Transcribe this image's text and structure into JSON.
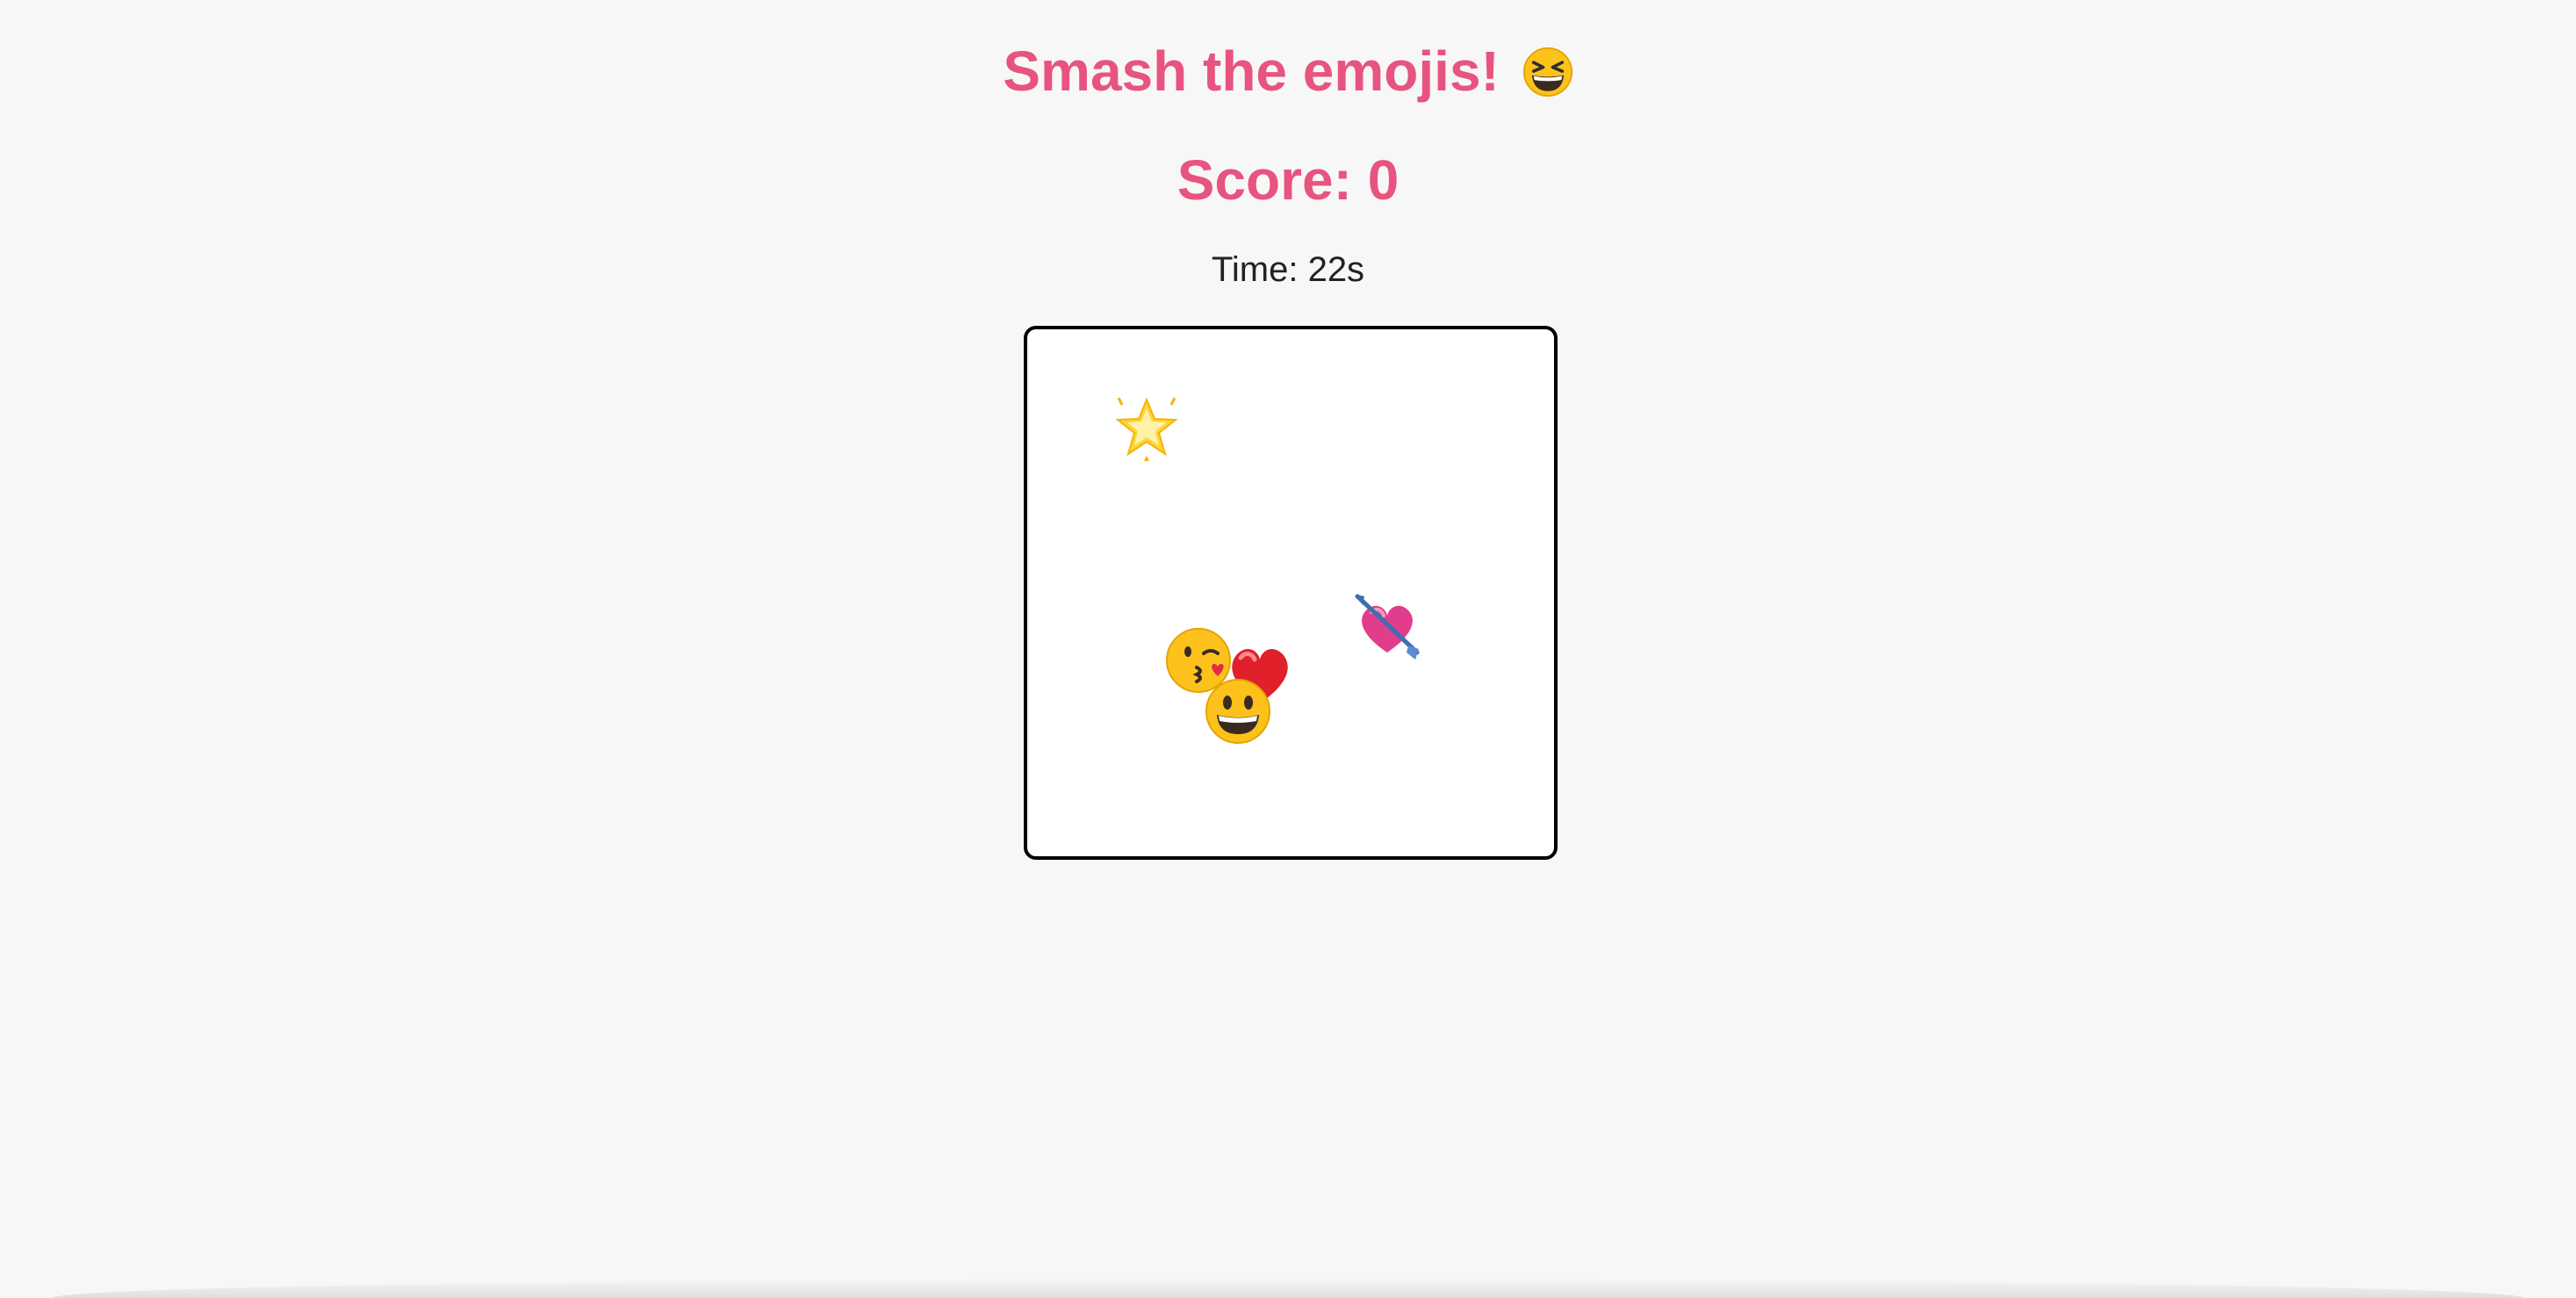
{
  "game": {
    "title": "Smash the emojis!",
    "title_icon": "grinning-squinting-face-icon",
    "score_label": "Score: 0",
    "score": 0,
    "time_label": "Time: 22s",
    "time_remaining_s": 22
  },
  "board": {
    "targets": [
      {
        "name": "glowing-star-icon",
        "emoji": "🌟"
      },
      {
        "name": "heart-with-arrow-icon",
        "emoji": "💘"
      },
      {
        "name": "face-blowing-kiss-icon",
        "emoji": "😘"
      },
      {
        "name": "red-heart-icon",
        "emoji": "❤️"
      },
      {
        "name": "grinning-face-big-eyes-icon",
        "emoji": "😃"
      }
    ]
  },
  "colors": {
    "accent": "#e75480",
    "background": "#f7f7f7",
    "board_background": "#ffffff",
    "board_border": "#000000"
  }
}
